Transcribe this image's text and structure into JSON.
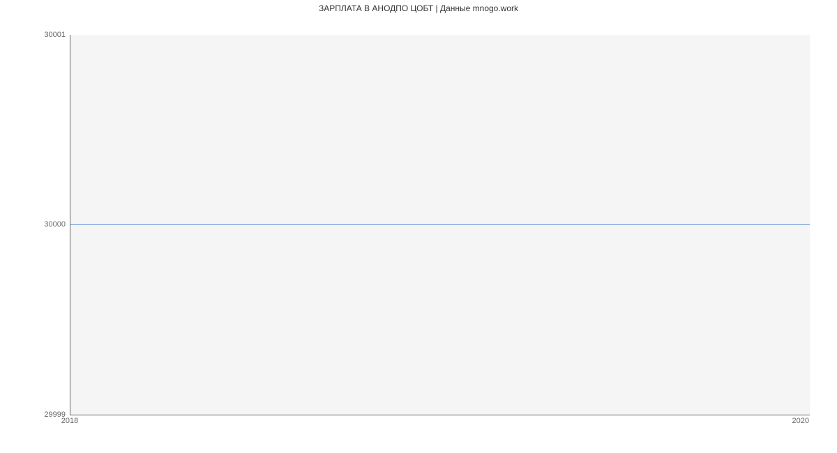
{
  "chart_data": {
    "type": "line",
    "title": "ЗАРПЛАТА В АНОДПО ЦОБТ | Данные mnogo.work",
    "xlabel": "",
    "ylabel": "",
    "x": [
      2018,
      2020
    ],
    "values": [
      30000,
      30000
    ],
    "xlim": [
      2018,
      2020
    ],
    "ylim": [
      29999,
      30001
    ],
    "x_ticks": [
      "2018",
      "2020"
    ],
    "y_ticks": [
      "29999",
      "30000",
      "30001"
    ],
    "line_color": "#6f9bd8"
  }
}
